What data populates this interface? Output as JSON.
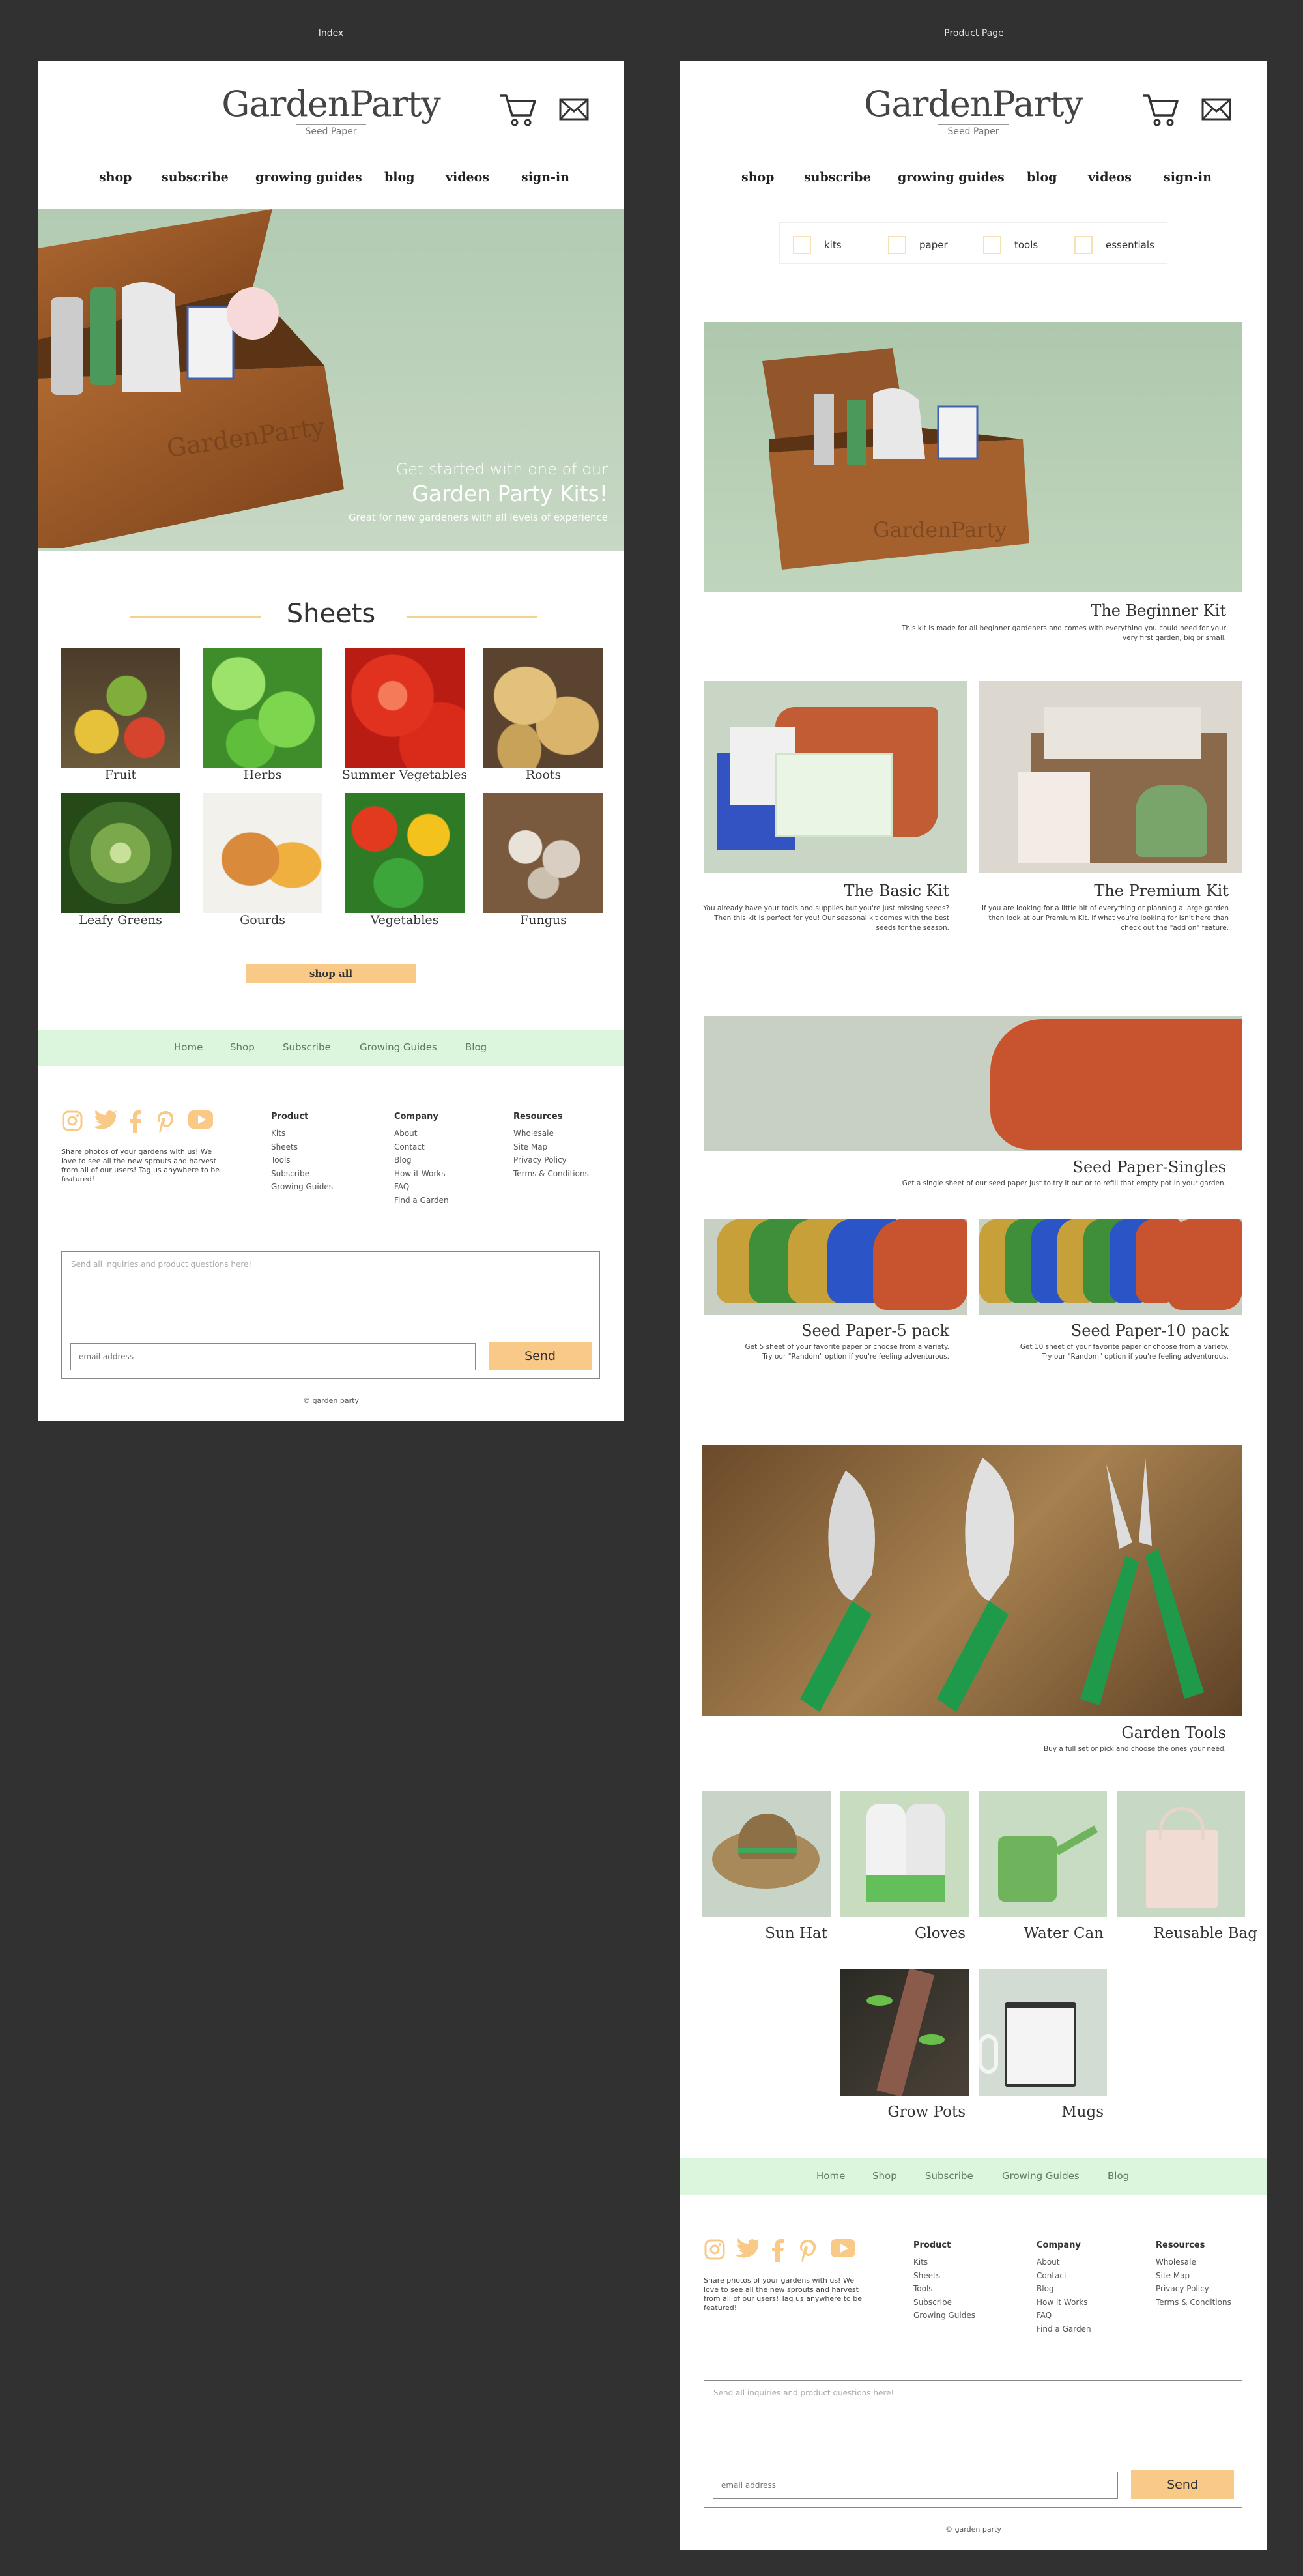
{
  "canvas": {
    "background": "#313131"
  },
  "frames": {
    "index_label": "Index",
    "product_label": "Product Page"
  },
  "brand": {
    "name": "GardenParty",
    "tagline": "Seed Paper"
  },
  "icons": [
    "cart-icon",
    "mail-icon",
    "instagram-icon",
    "twitter-icon",
    "facebook-icon",
    "pinterest-icon",
    "youtube-icon"
  ],
  "colors": {
    "accent": "#f8c987",
    "footer_nav_bg": "#dcf6dd",
    "hero_bg": "#b8cfb6"
  },
  "nav": [
    "shop",
    "subscribe",
    "growing guides",
    "blog",
    "videos",
    "sign-in"
  ],
  "hero": {
    "line1": "Get started with one of our",
    "line2": "Garden Party Kits!",
    "line3": "Great for new gardeners with all levels of experience"
  },
  "sheets": {
    "title": "Sheets",
    "items": [
      "Fruit",
      "Herbs",
      "Summer Vegetables",
      "Roots",
      "Leafy Greens",
      "Gourds",
      "Vegetables",
      "Fungus"
    ],
    "button": "shop all"
  },
  "footer": {
    "nav": [
      "Home",
      "Shop",
      "Subscribe",
      "Growing Guides",
      "Blog"
    ],
    "share_text": "Share photos of your gardens with us! We love to see all the new sprouts and harvest from all of our users! Tag us anywhere to be featured!",
    "columns": [
      {
        "title": "Product",
        "items": [
          "Kits",
          "Sheets",
          "Tools",
          "Subscribe",
          "Growing Guides"
        ]
      },
      {
        "title": "Company",
        "items": [
          "About",
          "Contact",
          "Blog",
          "How it Works",
          "FAQ",
          "Find a Garden"
        ]
      },
      {
        "title": "Resources",
        "items": [
          "Wholesale",
          "Site Map",
          "Privacy Policy",
          "Terms & Conditions"
        ]
      }
    ],
    "contact_placeholder": "Send all inquiries and product questions here!",
    "email_placeholder": "email address",
    "send": "Send",
    "copyright": "© garden party"
  },
  "product": {
    "filters": [
      "kits",
      "paper",
      "tools",
      "essentials"
    ],
    "beginner": {
      "title": "The Beginner Kit",
      "desc": "This kit is made for all beginner gardeners and comes with everything you could need for your very first garden, big or small."
    },
    "basic": {
      "title": "The Basic Kit",
      "desc": "You already have your tools and supplies but you're just missing seeds? Then this kit is perfect for you! Our seasonal kit comes with the best seeds for the season."
    },
    "premium": {
      "title": "The Premium Kit",
      "desc": "If you are looking for a little bit of everything or planning a large garden then look at our Premium Kit. If what you're looking for isn't here than check out the \"add on\" feature."
    },
    "singles": {
      "title": "Seed Paper-Singles",
      "desc": "Get a single sheet of our seed paper just to try it out or to refill that empty pot in your garden."
    },
    "five": {
      "title": "Seed Paper-5 pack",
      "desc": "Get 5 sheet of your favorite paper or choose from a variety. Try our \"Random\" option if you're feeling adventurous."
    },
    "ten": {
      "title": "Seed Paper-10 pack",
      "desc": "Get 10 sheet of your favorite paper or choose from a variety. Try our \"Random\" option if you're feeling adventurous."
    },
    "tools": {
      "title": "Garden Tools",
      "desc": "Buy a full set or pick and choose the ones your need."
    },
    "accessories": [
      "Sun Hat",
      "Gloves",
      "Water Can",
      "Reusable Bag",
      "Grow Pots",
      "Mugs"
    ]
  }
}
